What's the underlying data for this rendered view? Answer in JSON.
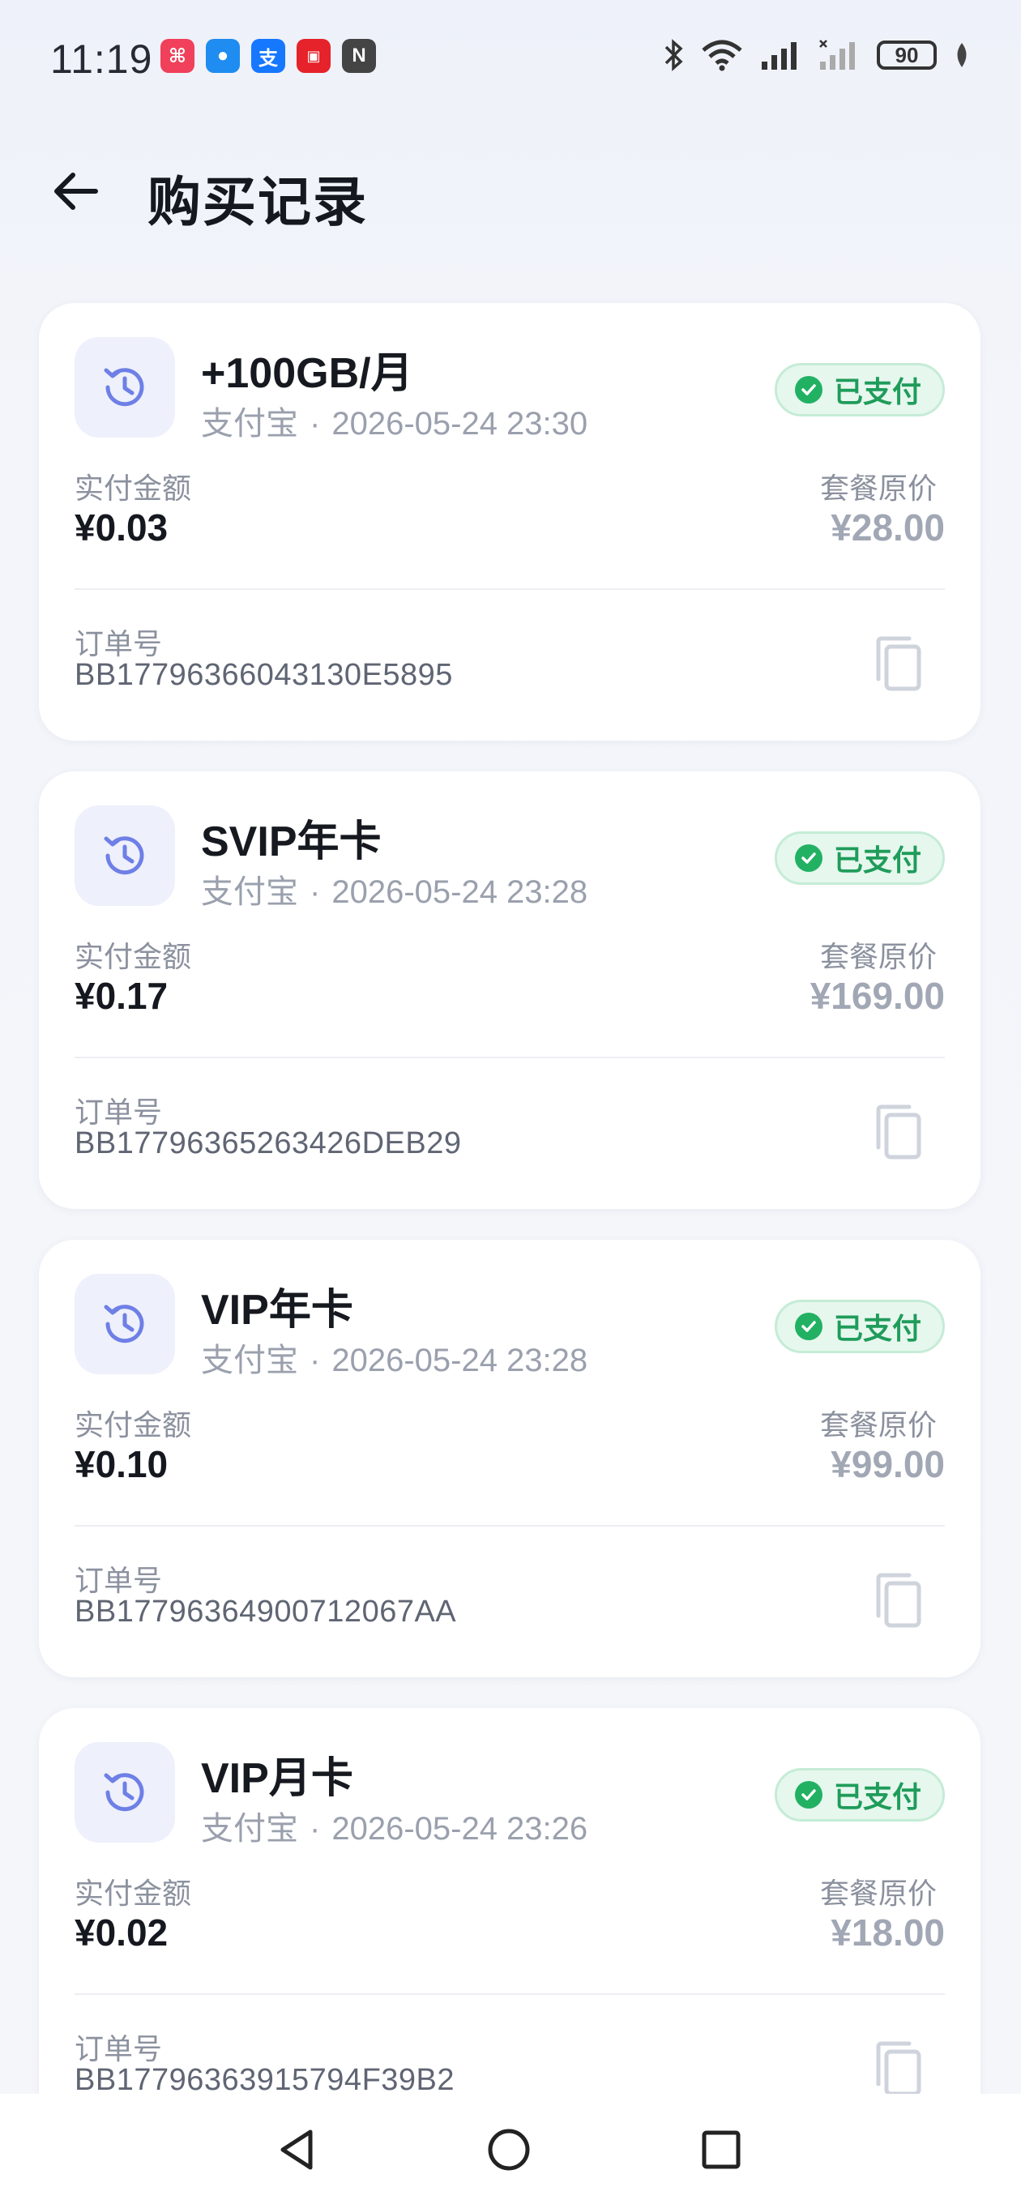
{
  "status_bar": {
    "time": "11:19",
    "battery": "90",
    "app_icons": [
      {
        "name": "app-icon-red",
        "color": "#f0405a",
        "glyph": "⌘"
      },
      {
        "name": "chat-app-icon",
        "color": "#1e8cf0",
        "glyph": "●"
      },
      {
        "name": "alipay-icon",
        "color": "#1677ff",
        "glyph": "支"
      },
      {
        "name": "app-icon-promo",
        "color": "#e6222a",
        "glyph": "▣"
      },
      {
        "name": "nfc-icon",
        "color": "#444444",
        "glyph": "N"
      }
    ]
  },
  "header": {
    "title": "购买记录"
  },
  "colors": {
    "accent_icon": "#6e7fe6",
    "paid_green": "#22b163"
  },
  "orders": [
    {
      "title": "+100GB/月",
      "method": "支付宝",
      "time": "2026-05-24 23:30",
      "status": "已支付",
      "paid_label": "实付金额",
      "paid_amount": "¥0.03",
      "orig_label": "套餐原价",
      "orig_amount": "¥28.00",
      "order_label": "订单号",
      "order_no": "BB17796366043130E5895"
    },
    {
      "title": "SVIP年卡",
      "method": "支付宝",
      "time": "2026-05-24 23:28",
      "status": "已支付",
      "paid_label": "实付金额",
      "paid_amount": "¥0.17",
      "orig_label": "套餐原价",
      "orig_amount": "¥169.00",
      "order_label": "订单号",
      "order_no": "BB17796365263426DEB29"
    },
    {
      "title": "VIP年卡",
      "method": "支付宝",
      "time": "2026-05-24 23:28",
      "status": "已支付",
      "paid_label": "实付金额",
      "paid_amount": "¥0.10",
      "orig_label": "套餐原价",
      "orig_amount": "¥99.00",
      "order_label": "订单号",
      "order_no": "BB17796364900712067AA"
    },
    {
      "title": "VIP月卡",
      "method": "支付宝",
      "time": "2026-05-24 23:26",
      "status": "已支付",
      "paid_label": "实付金额",
      "paid_amount": "¥0.02",
      "orig_label": "套餐原价",
      "orig_amount": "¥18.00",
      "order_label": "订单号",
      "order_no": "BB17796363915794F39B2"
    }
  ]
}
